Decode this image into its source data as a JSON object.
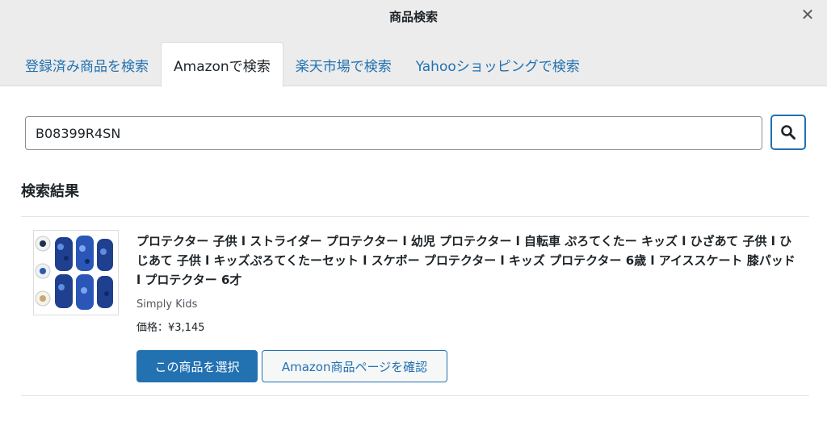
{
  "modal": {
    "title": "商品検索",
    "close_symbol": "✕"
  },
  "tabs": [
    {
      "label": "登録済み商品を検索",
      "active": false
    },
    {
      "label": "Amazonで検索",
      "active": true
    },
    {
      "label": "楽天市場で検索",
      "active": false
    },
    {
      "label": "Yahooショッピングで検索",
      "active": false
    }
  ],
  "search": {
    "value": "B08399R4SN",
    "button_icon": "search-icon"
  },
  "results": {
    "heading": "検索結果",
    "items": [
      {
        "title": "プロテクター 子供 l ストライダー プロテクター l 幼児 プロテクター l 自転車 ぷろてくたー キッズ l ひざあて 子供 l ひじあて 子供 l キッズぷろてくたーセット l スケボー プロテクター l キッズ プロテクター 6歳 l アイススケート 膝パッド l プロテクター 6才",
        "brand": "Simply Kids",
        "price": "価格：¥3,145",
        "select_label": "この商品を選択",
        "view_label": "Amazon商品ページを確認",
        "image": "product-thumbnail"
      }
    ]
  },
  "colors": {
    "accent": "#2271b1",
    "header_bg": "#ececec",
    "text": "#1d2327"
  }
}
